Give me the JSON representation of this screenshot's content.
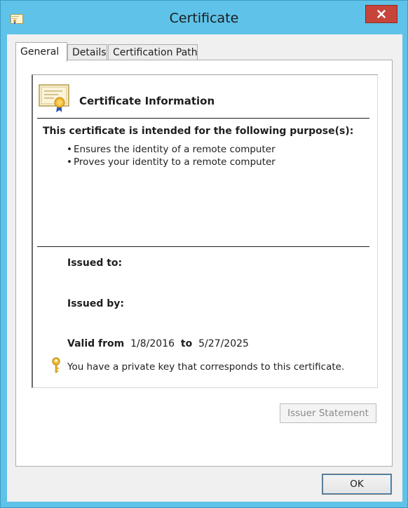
{
  "window": {
    "title": "Certificate",
    "icon": "certificate-icon",
    "accent_color": "#5fc2e8",
    "close_color": "#c7443a"
  },
  "tabs": [
    {
      "label": "General",
      "active": true
    },
    {
      "label": "Details",
      "active": false
    },
    {
      "label": "Certification Path",
      "active": false
    }
  ],
  "general": {
    "info_title": "Certificate Information",
    "purpose_heading": "This certificate is intended for the following purpose(s):",
    "purposes": [
      "Ensures the identity of a remote computer",
      "Proves your identity to a remote computer"
    ],
    "issued_to_label": "Issued to:",
    "issued_to_value": "",
    "issued_by_label": "Issued by:",
    "issued_by_value": "",
    "valid_from_label": "Valid from",
    "valid_from": "1/8/2016",
    "valid_to_label": "to",
    "valid_to": "5/27/2025",
    "private_key_note": "You have a private key that corresponds to this certificate."
  },
  "buttons": {
    "issuer_statement": "Issuer Statement",
    "ok": "OK"
  }
}
